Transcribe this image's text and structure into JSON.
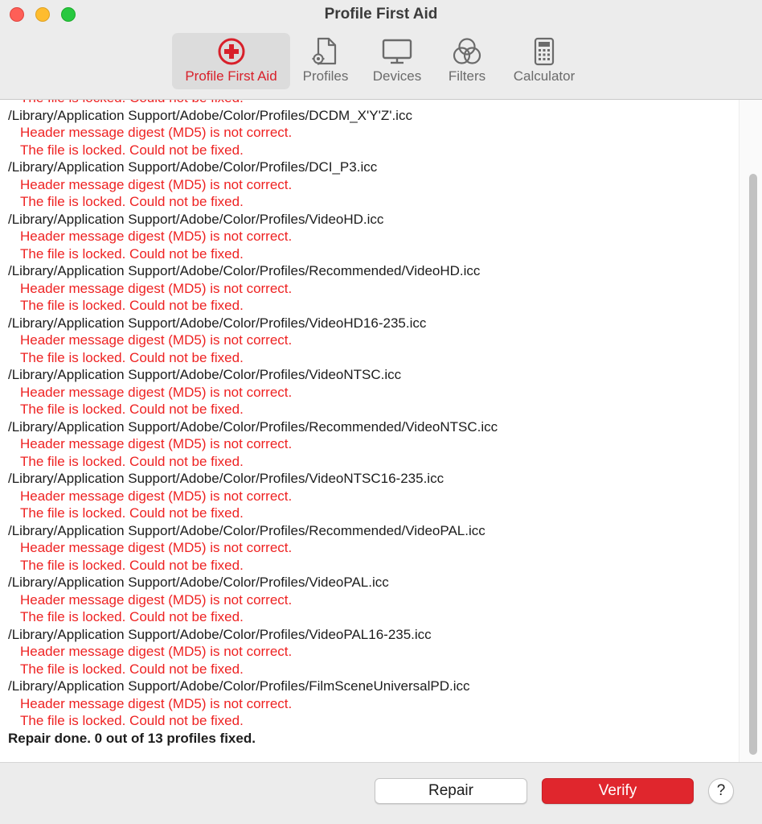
{
  "window": {
    "title": "Profile First Aid"
  },
  "toolbar": {
    "items": [
      {
        "label": "Profile First Aid",
        "icon": "first-aid-icon",
        "active": true
      },
      {
        "label": "Profiles",
        "icon": "profile-file-icon",
        "active": false
      },
      {
        "label": "Devices",
        "icon": "monitor-icon",
        "active": false
      },
      {
        "label": "Filters",
        "icon": "filters-circles-icon",
        "active": false
      },
      {
        "label": "Calculator",
        "icon": "calculator-icon",
        "active": false
      }
    ],
    "active_color": "#d8202a"
  },
  "log": {
    "partial_top": "The file is locked. Could not be fixed.",
    "entries": [
      {
        "path": "/Library/Application Support/Adobe/Color/Profiles/DCDM_X'Y'Z'.icc",
        "errors": [
          "Header message digest (MD5) is not correct.",
          "The file is locked. Could not be fixed."
        ]
      },
      {
        "path": "/Library/Application Support/Adobe/Color/Profiles/DCI_P3.icc",
        "errors": [
          "Header message digest (MD5) is not correct.",
          "The file is locked. Could not be fixed."
        ]
      },
      {
        "path": "/Library/Application Support/Adobe/Color/Profiles/VideoHD.icc",
        "errors": [
          "Header message digest (MD5) is not correct.",
          "The file is locked. Could not be fixed."
        ]
      },
      {
        "path": "/Library/Application Support/Adobe/Color/Profiles/Recommended/VideoHD.icc",
        "errors": [
          "Header message digest (MD5) is not correct.",
          "The file is locked. Could not be fixed."
        ]
      },
      {
        "path": "/Library/Application Support/Adobe/Color/Profiles/VideoHD16-235.icc",
        "errors": [
          "Header message digest (MD5) is not correct.",
          "The file is locked. Could not be fixed."
        ]
      },
      {
        "path": "/Library/Application Support/Adobe/Color/Profiles/VideoNTSC.icc",
        "errors": [
          "Header message digest (MD5) is not correct.",
          "The file is locked. Could not be fixed."
        ]
      },
      {
        "path": "/Library/Application Support/Adobe/Color/Profiles/Recommended/VideoNTSC.icc",
        "errors": [
          "Header message digest (MD5) is not correct.",
          "The file is locked. Could not be fixed."
        ]
      },
      {
        "path": "/Library/Application Support/Adobe/Color/Profiles/VideoNTSC16-235.icc",
        "errors": [
          "Header message digest (MD5) is not correct.",
          "The file is locked. Could not be fixed."
        ]
      },
      {
        "path": "/Library/Application Support/Adobe/Color/Profiles/Recommended/VideoPAL.icc",
        "errors": [
          "Header message digest (MD5) is not correct.",
          "The file is locked. Could not be fixed."
        ]
      },
      {
        "path": "/Library/Application Support/Adobe/Color/Profiles/VideoPAL.icc",
        "errors": [
          "Header message digest (MD5) is not correct.",
          "The file is locked. Could not be fixed."
        ]
      },
      {
        "path": "/Library/Application Support/Adobe/Color/Profiles/VideoPAL16-235.icc",
        "errors": [
          "Header message digest (MD5) is not correct.",
          "The file is locked. Could not be fixed."
        ]
      },
      {
        "path": "/Library/Application Support/Adobe/Color/Profiles/FilmSceneUniversalPD.icc",
        "errors": [
          "Header message digest (MD5) is not correct.",
          "The file is locked. Could not be fixed."
        ]
      }
    ],
    "summary": "Repair done. 0 out of 13 profiles fixed.",
    "error_color": "#ee2222"
  },
  "buttons": {
    "repair_label": "Repair",
    "verify_label": "Verify",
    "help_label": "?",
    "verify_color": "#e0262d"
  }
}
